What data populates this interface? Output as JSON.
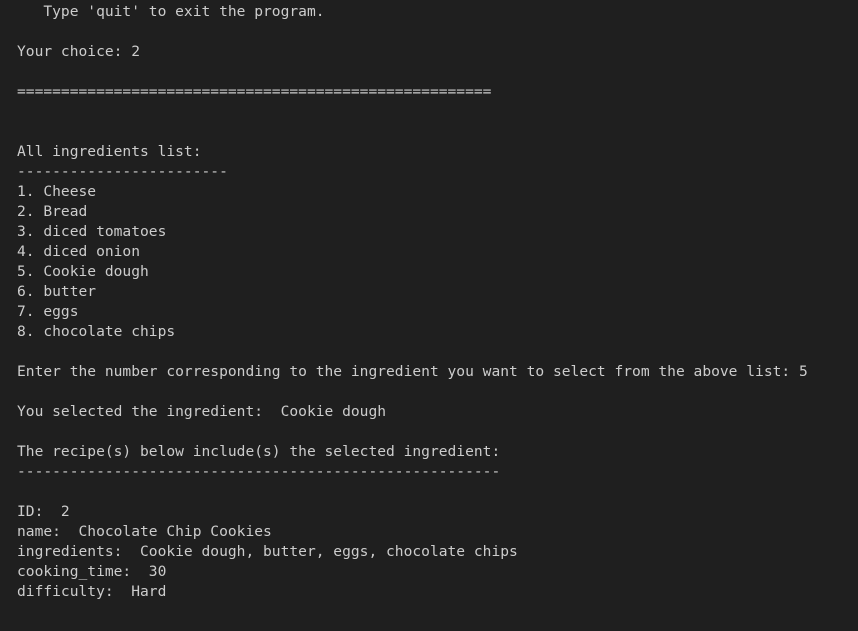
{
  "terminal": {
    "lines": [
      "   Type 'quit' to exit the program.",
      "",
      "Your choice: 2",
      "",
      "======================================================",
      "",
      "",
      "All ingredients list:",
      "------------------------",
      "1. Cheese",
      "2. Bread",
      "3. diced tomatoes",
      "4. diced onion",
      "5. Cookie dough",
      "6. butter",
      "7. eggs",
      "8. chocolate chips",
      "",
      "Enter the number corresponding to the ingredient you want to select from the above list: 5",
      "",
      "You selected the ingredient:  Cookie dough",
      "",
      "The recipe(s) below include(s) the selected ingredient:",
      "-------------------------------------------------------",
      "",
      "ID:  2",
      "name:  Chocolate Chip Cookies",
      "ingredients:  Cookie dough, butter, eggs, chocolate chips",
      "cooking_time:  30",
      "difficulty:  Hard"
    ]
  }
}
